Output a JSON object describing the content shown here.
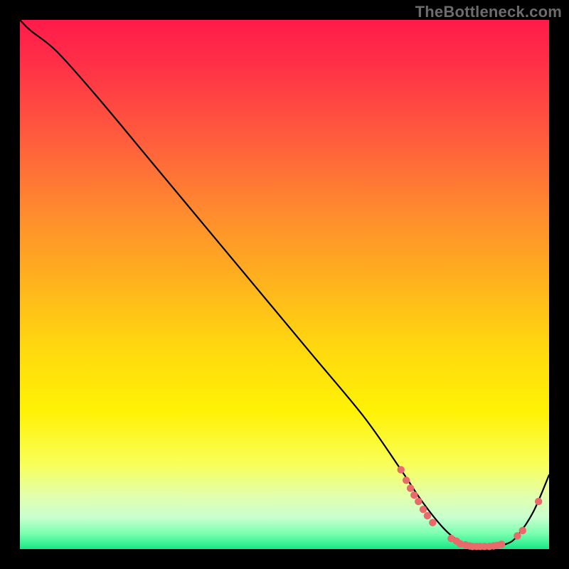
{
  "watermark": "TheBottleneck.com",
  "colors": {
    "background": "#000000",
    "gradient_top": "#ff1b4a",
    "gradient_bottom": "#17e887",
    "curve_stroke": "#000000",
    "marker_fill": "#e86a6a"
  },
  "chart_data": {
    "type": "line",
    "title": "",
    "xlabel": "",
    "ylabel": "",
    "xlim": [
      0,
      100
    ],
    "ylim": [
      0,
      100
    ],
    "grid": false,
    "legend": false,
    "notes": "Background is a vertical red→yellow→green gradient inside a black frame. A single black curve descends from top-left, reaches a flat minimum near the right, then rises. Salmon-colored markers sit along the valley region.",
    "series": [
      {
        "name": "curve",
        "x": [
          0,
          2,
          7,
          15,
          25,
          35,
          45,
          55,
          65,
          72,
          76,
          80,
          83,
          86,
          89,
          92,
          94,
          97,
          100
        ],
        "y": [
          100,
          98,
          94,
          85,
          73,
          61,
          49,
          37,
          25,
          15,
          9,
          4,
          1.5,
          0.5,
          0.5,
          1,
          2.5,
          7,
          14
        ]
      }
    ],
    "markers": [
      {
        "x": 72.0,
        "y": 15.0
      },
      {
        "x": 73.0,
        "y": 13.0
      },
      {
        "x": 73.8,
        "y": 11.5
      },
      {
        "x": 74.5,
        "y": 10.2
      },
      {
        "x": 75.3,
        "y": 9.0
      },
      {
        "x": 76.2,
        "y": 7.5
      },
      {
        "x": 77.0,
        "y": 6.3
      },
      {
        "x": 78.0,
        "y": 5.0
      },
      {
        "x": 81.5,
        "y": 2.0
      },
      {
        "x": 82.5,
        "y": 1.5
      },
      {
        "x": 83.2,
        "y": 1.0
      },
      {
        "x": 84.2,
        "y": 0.8
      },
      {
        "x": 85.0,
        "y": 0.6
      },
      {
        "x": 85.5,
        "y": 0.5
      },
      {
        "x": 86.3,
        "y": 0.5
      },
      {
        "x": 87.0,
        "y": 0.5
      },
      {
        "x": 87.8,
        "y": 0.5
      },
      {
        "x": 88.7,
        "y": 0.5
      },
      {
        "x": 89.5,
        "y": 0.6
      },
      {
        "x": 90.2,
        "y": 0.7
      },
      {
        "x": 91.0,
        "y": 0.9
      },
      {
        "x": 94.0,
        "y": 2.5
      },
      {
        "x": 95.0,
        "y": 3.5
      },
      {
        "x": 98.0,
        "y": 9.0
      }
    ]
  }
}
